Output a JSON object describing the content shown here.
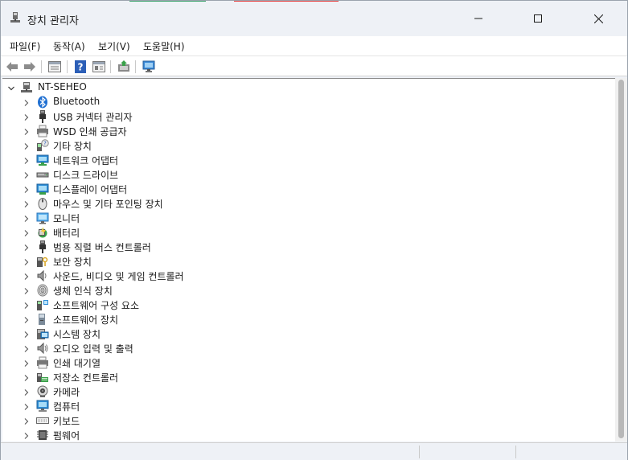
{
  "window": {
    "title": "장치 관리자"
  },
  "menu": [
    {
      "label": "파일(F)"
    },
    {
      "label": "동작(A)"
    },
    {
      "label": "보기(V)"
    },
    {
      "label": "도움말(H)"
    }
  ],
  "toolbar": [
    "back-icon",
    "forward-icon",
    "properties-view-icon",
    "help-icon",
    "details-view-icon",
    "update-driver-icon",
    "monitor-scan-icon"
  ],
  "tree": {
    "root": {
      "label": "NT-SEHEO",
      "expanded": true
    },
    "items": [
      {
        "label": "Bluetooth",
        "icon": "bluetooth-icon"
      },
      {
        "label": "USB 커넥터 관리자",
        "icon": "usb-connector-icon"
      },
      {
        "label": "WSD 인쇄 공급자",
        "icon": "printer-icon"
      },
      {
        "label": "기타 장치",
        "icon": "unknown-device-icon"
      },
      {
        "label": "네트워크 어댑터",
        "icon": "network-adapter-icon"
      },
      {
        "label": "디스크 드라이브",
        "icon": "disk-drive-icon"
      },
      {
        "label": "디스플레이 어댑터",
        "icon": "display-adapter-icon"
      },
      {
        "label": "마우스 및 기타 포인팅 장치",
        "icon": "mouse-icon"
      },
      {
        "label": "모니터",
        "icon": "monitor-icon"
      },
      {
        "label": "배터리",
        "icon": "battery-icon"
      },
      {
        "label": "범용 직렬 버스 컨트롤러",
        "icon": "usb-controller-icon"
      },
      {
        "label": "보안 장치",
        "icon": "security-device-icon"
      },
      {
        "label": "사운드, 비디오 및 게임 컨트롤러",
        "icon": "sound-icon"
      },
      {
        "label": "생체 인식 장치",
        "icon": "fingerprint-icon"
      },
      {
        "label": "소프트웨어 구성 요소",
        "icon": "software-component-icon"
      },
      {
        "label": "소프트웨어 장치",
        "icon": "software-device-icon"
      },
      {
        "label": "시스템 장치",
        "icon": "system-device-icon"
      },
      {
        "label": "오디오 입력 및 출력",
        "icon": "speaker-icon"
      },
      {
        "label": "인쇄 대기열",
        "icon": "print-queue-icon"
      },
      {
        "label": "저장소 컨트롤러",
        "icon": "storage-controller-icon"
      },
      {
        "label": "카메라",
        "icon": "camera-icon"
      },
      {
        "label": "컴퓨터",
        "icon": "computer-icon"
      },
      {
        "label": "키보드",
        "icon": "keyboard-icon"
      },
      {
        "label": "펌웨어",
        "icon": "firmware-icon"
      }
    ]
  },
  "colors": {
    "accent": "#2a6fd6",
    "chrome": "#eef1f6"
  }
}
